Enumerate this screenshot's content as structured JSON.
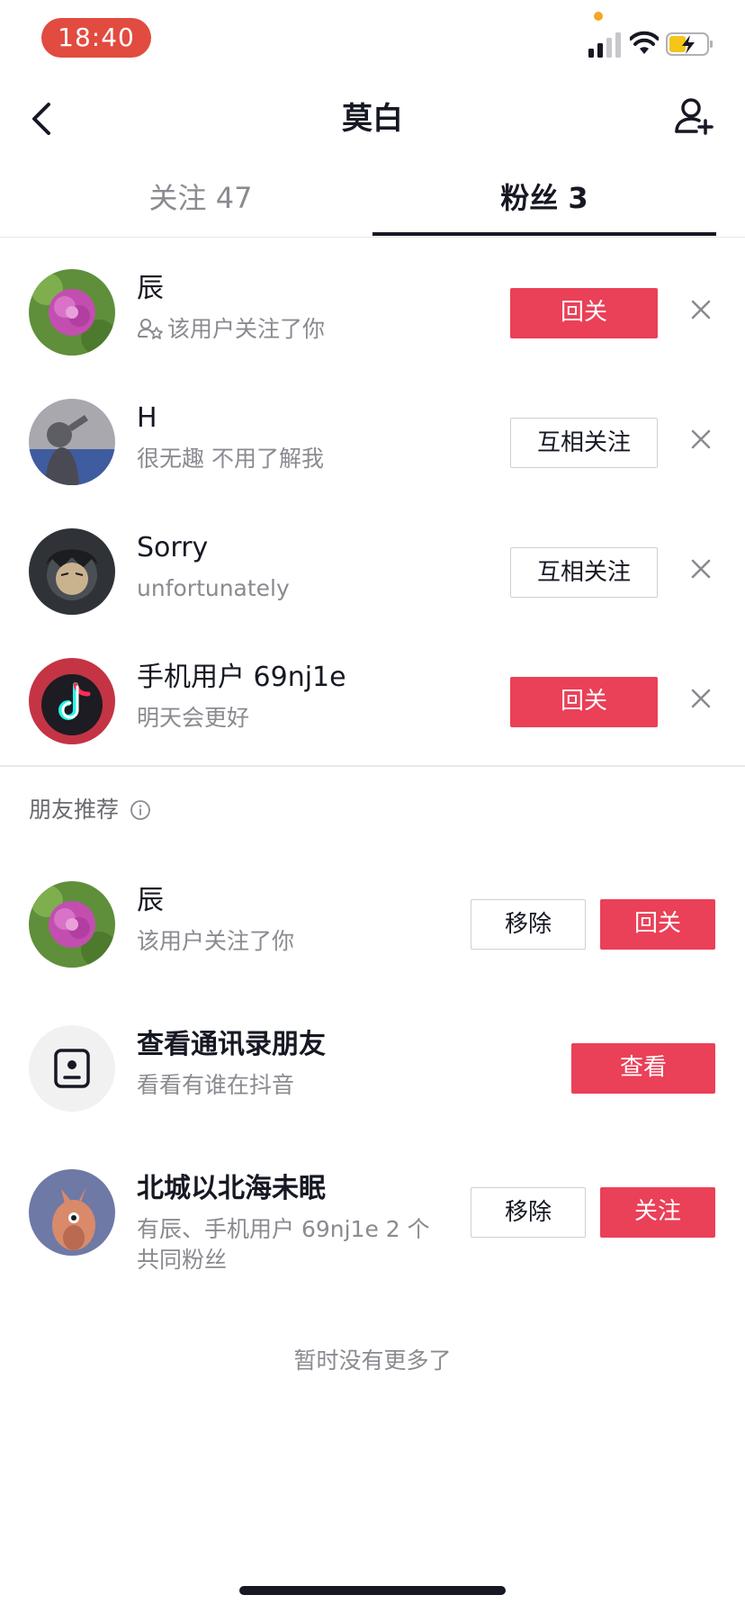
{
  "status_bar": {
    "time": "18:40"
  },
  "nav": {
    "title": "莫白"
  },
  "tabs": {
    "following": "关注 47",
    "followers": "粉丝 3"
  },
  "followers": [
    {
      "name": "辰",
      "subtitle": "该用户关注了你",
      "action": "回关"
    },
    {
      "name": "H",
      "subtitle": "很无趣 不用了解我",
      "action": "互相关注"
    },
    {
      "name": "Sorry",
      "subtitle": "unfortunately",
      "action": "互相关注"
    },
    {
      "name": "手机用户 69nj1e",
      "subtitle": "明天会更好",
      "action": "回关"
    }
  ],
  "recommend": {
    "header": "朋友推荐",
    "items": [
      {
        "name": "辰",
        "subtitle": "该用户关注了你",
        "secondary": "移除",
        "primary": "回关"
      },
      {
        "name": "查看通讯录朋友",
        "subtitle": "看看有谁在抖音",
        "primary": "查看"
      },
      {
        "name": "北城以北海未眠",
        "subtitle": "有辰、手机用户 69nj1e 2 个共同粉丝",
        "secondary": "移除",
        "primary": "关注"
      }
    ]
  },
  "footer": "暂时没有更多了",
  "colors": {
    "accent": "#ea4058",
    "time_pill": "#e24b3f",
    "text": "#161823",
    "muted": "#8a8b91"
  }
}
